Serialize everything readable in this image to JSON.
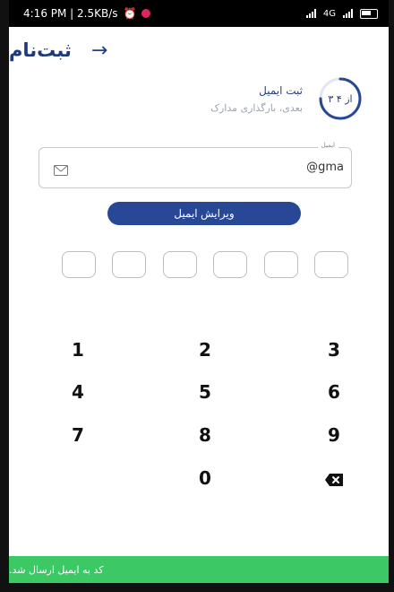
{
  "status_bar": {
    "time_speed": "4:16 PM | 2.5KB/s",
    "network": "4G"
  },
  "header": {
    "title": "ثبت‌نام",
    "back_icon": "arrow-right-icon"
  },
  "step": {
    "progress_label": "۳ از ۴",
    "progress_fraction": 0.75,
    "current_title": "ثبت ایمیل",
    "next_label": "بعدی، بارگذاری مدارک"
  },
  "email": {
    "label": "ایمیل",
    "value": "@gma",
    "icon": "mail-icon"
  },
  "edit_button": {
    "label": "ویرایش ایمیل"
  },
  "otp": {
    "length": 6
  },
  "keypad": {
    "keys": [
      "1",
      "2",
      "3",
      "4",
      "5",
      "6",
      "7",
      "8",
      "9",
      "0"
    ],
    "delete_icon": "backspace-icon"
  },
  "toast": {
    "message": "کد به ایمیل ارسال شد."
  },
  "colors": {
    "primary": "#284896",
    "success": "#3cc864",
    "title": "#1f3a7a"
  }
}
